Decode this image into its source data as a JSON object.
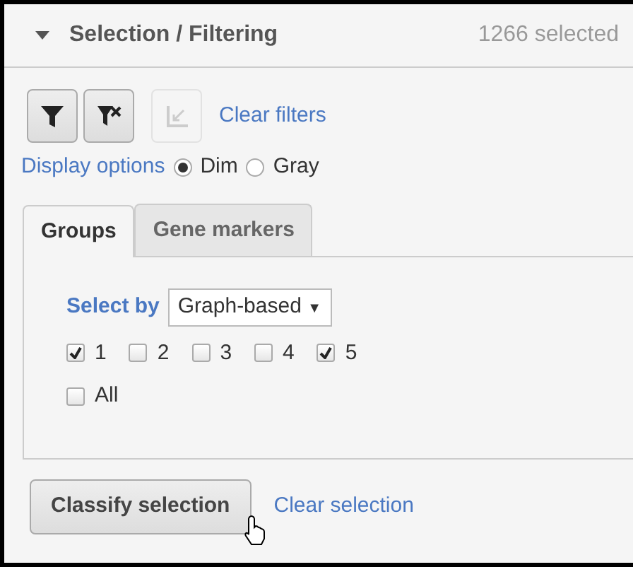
{
  "header": {
    "expanded": true,
    "title": "Selection / Filtering",
    "count": "1266 selected"
  },
  "toolbar": {
    "buttons": [
      {
        "kind": "filter",
        "disabled": false
      },
      {
        "kind": "filter-clear",
        "disabled": false
      },
      {
        "kind": "chart",
        "disabled": true
      }
    ],
    "link": "Clear filters"
  },
  "display_options": {
    "label": "Display options",
    "options": [
      {
        "label": "Dim",
        "selected": true
      },
      {
        "label": "Gray",
        "selected": false
      }
    ]
  },
  "tabs": [
    {
      "label": "Groups",
      "selected": true
    },
    {
      "label": "Gene markers",
      "selected": false
    }
  ],
  "select_by": {
    "label": "Select by",
    "value": "Graph-based",
    "caret": "▼"
  },
  "groups": [
    {
      "label": "1",
      "checked": true
    },
    {
      "label": "2",
      "checked": false
    },
    {
      "label": "3",
      "checked": false
    },
    {
      "label": "4",
      "checked": false
    },
    {
      "label": "5",
      "checked": true
    }
  ],
  "all": {
    "label": "All",
    "checked": false
  },
  "footer": {
    "button": "Classify selection",
    "link": "Clear selection"
  }
}
